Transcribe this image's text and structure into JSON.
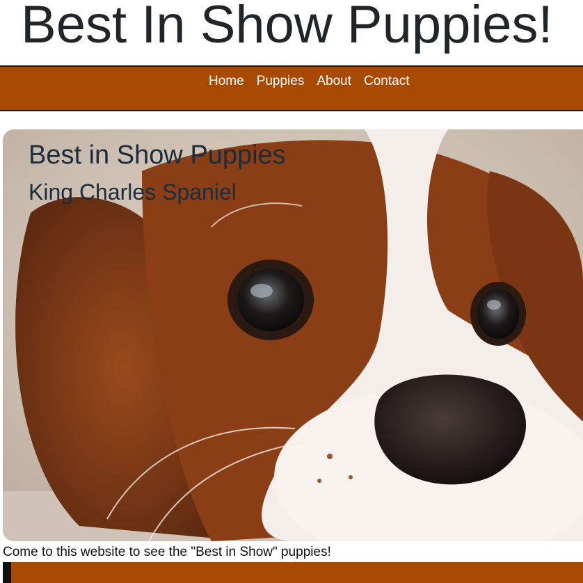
{
  "header": {
    "site_title": "Best In Show Puppies!"
  },
  "nav": {
    "items": [
      {
        "label": "Home"
      },
      {
        "label": "Puppies"
      },
      {
        "label": "About"
      },
      {
        "label": "Contact"
      }
    ]
  },
  "hero": {
    "title": "Best in Show Puppies",
    "subtitle": "King Charles Spaniel",
    "image_subject": "king-charles-spaniel-photo"
  },
  "main": {
    "tagline": "Come to this website to see the \"Best in Show\" puppies!"
  },
  "colors": {
    "nav_bg": "#a84a04",
    "title_text": "#212529",
    "hero_text": "#1c2c3a"
  }
}
